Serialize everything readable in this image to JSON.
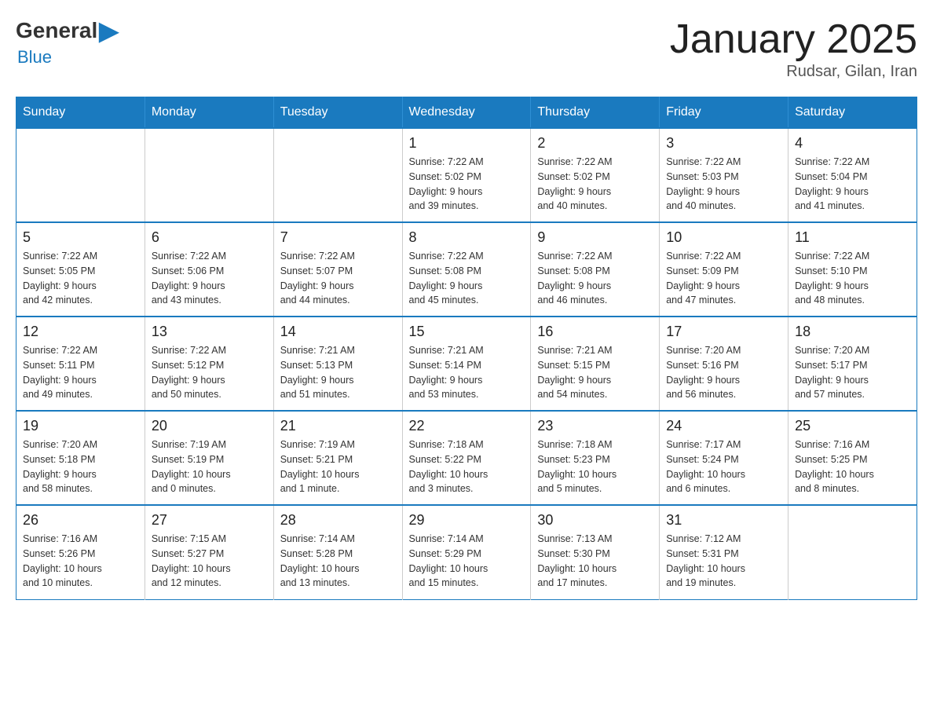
{
  "header": {
    "logo_general": "General",
    "logo_blue": "Blue",
    "title": "January 2025",
    "subtitle": "Rudsar, Gilan, Iran"
  },
  "weekdays": [
    "Sunday",
    "Monday",
    "Tuesday",
    "Wednesday",
    "Thursday",
    "Friday",
    "Saturday"
  ],
  "weeks": [
    [
      {
        "day": "",
        "info": ""
      },
      {
        "day": "",
        "info": ""
      },
      {
        "day": "",
        "info": ""
      },
      {
        "day": "1",
        "info": "Sunrise: 7:22 AM\nSunset: 5:02 PM\nDaylight: 9 hours\nand 39 minutes."
      },
      {
        "day": "2",
        "info": "Sunrise: 7:22 AM\nSunset: 5:02 PM\nDaylight: 9 hours\nand 40 minutes."
      },
      {
        "day": "3",
        "info": "Sunrise: 7:22 AM\nSunset: 5:03 PM\nDaylight: 9 hours\nand 40 minutes."
      },
      {
        "day": "4",
        "info": "Sunrise: 7:22 AM\nSunset: 5:04 PM\nDaylight: 9 hours\nand 41 minutes."
      }
    ],
    [
      {
        "day": "5",
        "info": "Sunrise: 7:22 AM\nSunset: 5:05 PM\nDaylight: 9 hours\nand 42 minutes."
      },
      {
        "day": "6",
        "info": "Sunrise: 7:22 AM\nSunset: 5:06 PM\nDaylight: 9 hours\nand 43 minutes."
      },
      {
        "day": "7",
        "info": "Sunrise: 7:22 AM\nSunset: 5:07 PM\nDaylight: 9 hours\nand 44 minutes."
      },
      {
        "day": "8",
        "info": "Sunrise: 7:22 AM\nSunset: 5:08 PM\nDaylight: 9 hours\nand 45 minutes."
      },
      {
        "day": "9",
        "info": "Sunrise: 7:22 AM\nSunset: 5:08 PM\nDaylight: 9 hours\nand 46 minutes."
      },
      {
        "day": "10",
        "info": "Sunrise: 7:22 AM\nSunset: 5:09 PM\nDaylight: 9 hours\nand 47 minutes."
      },
      {
        "day": "11",
        "info": "Sunrise: 7:22 AM\nSunset: 5:10 PM\nDaylight: 9 hours\nand 48 minutes."
      }
    ],
    [
      {
        "day": "12",
        "info": "Sunrise: 7:22 AM\nSunset: 5:11 PM\nDaylight: 9 hours\nand 49 minutes."
      },
      {
        "day": "13",
        "info": "Sunrise: 7:22 AM\nSunset: 5:12 PM\nDaylight: 9 hours\nand 50 minutes."
      },
      {
        "day": "14",
        "info": "Sunrise: 7:21 AM\nSunset: 5:13 PM\nDaylight: 9 hours\nand 51 minutes."
      },
      {
        "day": "15",
        "info": "Sunrise: 7:21 AM\nSunset: 5:14 PM\nDaylight: 9 hours\nand 53 minutes."
      },
      {
        "day": "16",
        "info": "Sunrise: 7:21 AM\nSunset: 5:15 PM\nDaylight: 9 hours\nand 54 minutes."
      },
      {
        "day": "17",
        "info": "Sunrise: 7:20 AM\nSunset: 5:16 PM\nDaylight: 9 hours\nand 56 minutes."
      },
      {
        "day": "18",
        "info": "Sunrise: 7:20 AM\nSunset: 5:17 PM\nDaylight: 9 hours\nand 57 minutes."
      }
    ],
    [
      {
        "day": "19",
        "info": "Sunrise: 7:20 AM\nSunset: 5:18 PM\nDaylight: 9 hours\nand 58 minutes."
      },
      {
        "day": "20",
        "info": "Sunrise: 7:19 AM\nSunset: 5:19 PM\nDaylight: 10 hours\nand 0 minutes."
      },
      {
        "day": "21",
        "info": "Sunrise: 7:19 AM\nSunset: 5:21 PM\nDaylight: 10 hours\nand 1 minute."
      },
      {
        "day": "22",
        "info": "Sunrise: 7:18 AM\nSunset: 5:22 PM\nDaylight: 10 hours\nand 3 minutes."
      },
      {
        "day": "23",
        "info": "Sunrise: 7:18 AM\nSunset: 5:23 PM\nDaylight: 10 hours\nand 5 minutes."
      },
      {
        "day": "24",
        "info": "Sunrise: 7:17 AM\nSunset: 5:24 PM\nDaylight: 10 hours\nand 6 minutes."
      },
      {
        "day": "25",
        "info": "Sunrise: 7:16 AM\nSunset: 5:25 PM\nDaylight: 10 hours\nand 8 minutes."
      }
    ],
    [
      {
        "day": "26",
        "info": "Sunrise: 7:16 AM\nSunset: 5:26 PM\nDaylight: 10 hours\nand 10 minutes."
      },
      {
        "day": "27",
        "info": "Sunrise: 7:15 AM\nSunset: 5:27 PM\nDaylight: 10 hours\nand 12 minutes."
      },
      {
        "day": "28",
        "info": "Sunrise: 7:14 AM\nSunset: 5:28 PM\nDaylight: 10 hours\nand 13 minutes."
      },
      {
        "day": "29",
        "info": "Sunrise: 7:14 AM\nSunset: 5:29 PM\nDaylight: 10 hours\nand 15 minutes."
      },
      {
        "day": "30",
        "info": "Sunrise: 7:13 AM\nSunset: 5:30 PM\nDaylight: 10 hours\nand 17 minutes."
      },
      {
        "day": "31",
        "info": "Sunrise: 7:12 AM\nSunset: 5:31 PM\nDaylight: 10 hours\nand 19 minutes."
      },
      {
        "day": "",
        "info": ""
      }
    ]
  ]
}
